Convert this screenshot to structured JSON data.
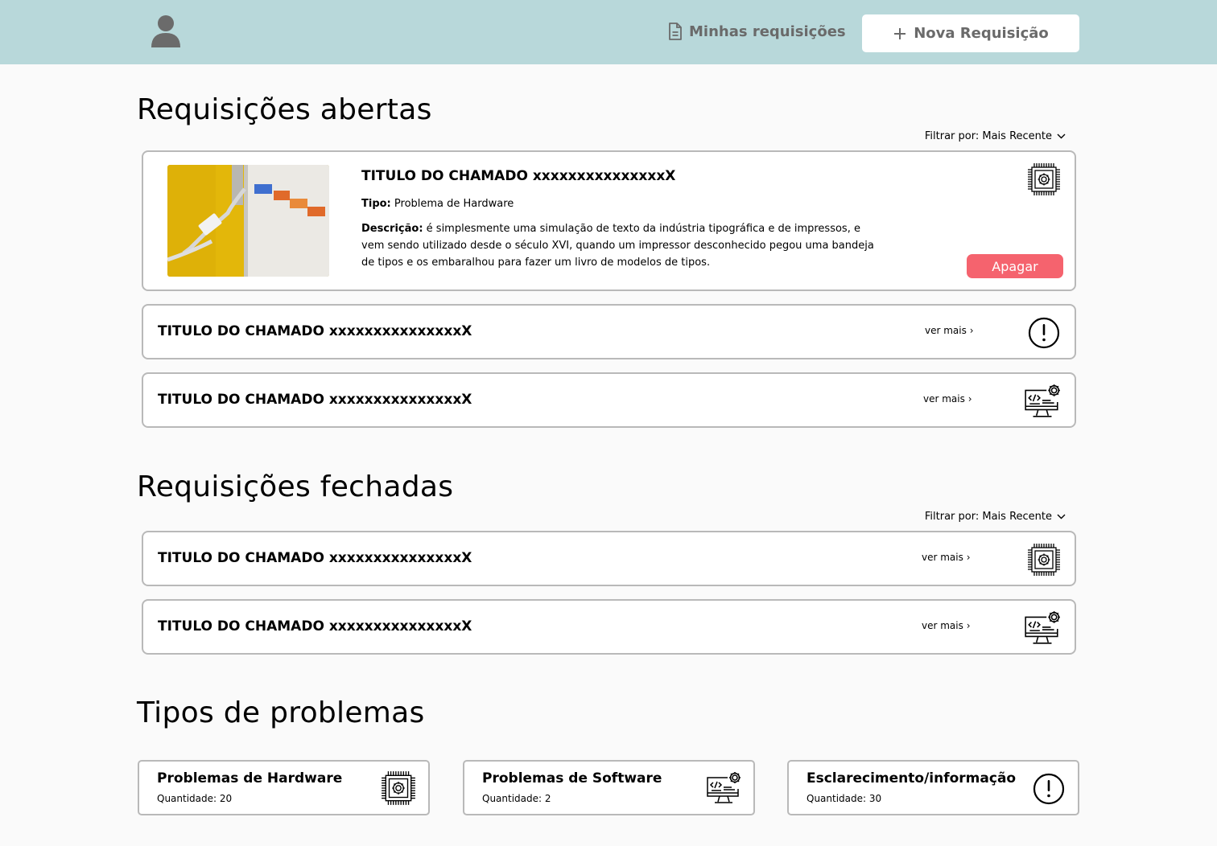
{
  "header": {
    "my_requests_label": "Minhas requisições",
    "new_request_label": "Nova Requisição",
    "icons": {
      "avatar": "user-icon",
      "my_requests": "document-icon",
      "new_request": "plus-icon"
    }
  },
  "open_requests": {
    "title": "Requisições abertas",
    "filter_label": "Filtrar por: Mais Recente",
    "featured": {
      "title": "TITULO DO CHAMADO xxxxxxxxxxxxxxxX",
      "tipo_label": "Tipo:",
      "tipo_value": "Problema de Hardware",
      "descricao_label": "Descrição:",
      "descricao_value": "é simplesmente uma simulação de texto da indústria tipográfica e de impressos, e vem sendo utilizado desde o século XVI, quando um impressor desconhecido pegou uma bandeja de tipos e os embaralhou para fazer um livro de modelos de tipos.",
      "delete_label": "Apagar",
      "icon": "hardware-chip-icon",
      "image": "router-ethernet-photo"
    },
    "items": [
      {
        "title": "TITULO DO CHAMADO xxxxxxxxxxxxxxxX",
        "link": "ver mais",
        "icon": "alert-icon"
      },
      {
        "title": "TITULO DO CHAMADO xxxxxxxxxxxxxxxX",
        "link": "ver mais",
        "icon": "software-monitor-icon"
      }
    ]
  },
  "closed_requests": {
    "title": "Requisições fechadas",
    "filter_label": "Filtrar por: Mais Recente",
    "items": [
      {
        "title": "TITULO DO CHAMADO xxxxxxxxxxxxxxxX",
        "link": "ver mais",
        "icon": "hardware-chip-icon"
      },
      {
        "title": "TITULO DO CHAMADO xxxxxxxxxxxxxxxX",
        "link": "ver mais",
        "icon": "software-monitor-icon"
      }
    ]
  },
  "problem_types": {
    "title": "Tipos de problemas",
    "items": [
      {
        "name": "Problemas de Hardware",
        "quantity": "Quantidade: 20",
        "icon": "hardware-chip-icon"
      },
      {
        "name": "Problemas de Software",
        "quantity": "Quantidade: 2",
        "icon": "software-monitor-icon"
      },
      {
        "name": "Esclarecimento/informação",
        "quantity": "Quantidade: 30",
        "icon": "alert-icon"
      }
    ]
  },
  "colors": {
    "header_bg": "#b8d8da",
    "delete_button": "#f5636e",
    "card_border": "#b9b9b9",
    "nav_text": "#6a6a6a"
  }
}
